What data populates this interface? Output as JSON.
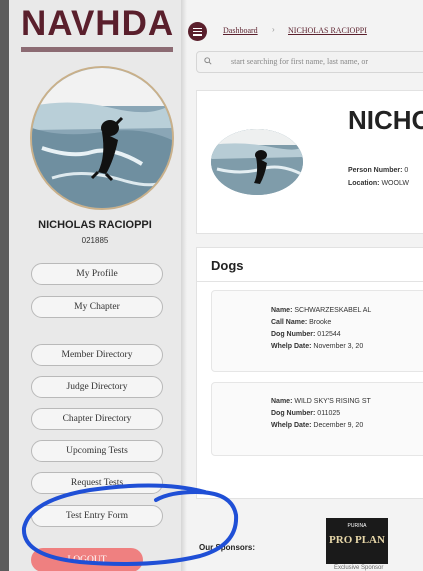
{
  "app": {
    "logo_text": "NAVHDA"
  },
  "breadcrumb": {
    "dashboard": "Dashboard",
    "current": "NICHOLAS RACIOPPI"
  },
  "search": {
    "placeholder": "start searching for first name, last name, or"
  },
  "profile": {
    "name": "NICHOLAS RACIOPPI",
    "number": "021885"
  },
  "sidebar": {
    "buttons": [
      {
        "label": "My Profile"
      },
      {
        "label": "My Chapter"
      },
      {
        "label": "Member Directory"
      },
      {
        "label": "Judge Directory"
      },
      {
        "label": "Chapter Directory"
      },
      {
        "label": "Upcoming Tests"
      },
      {
        "label": "Request Tests"
      },
      {
        "label": "Test Entry Form"
      }
    ],
    "logout": "LOGOUT"
  },
  "header_card": {
    "name": "NICHO",
    "person_number_label": "Person Number:",
    "person_number_value": "0",
    "location_label": "Location:",
    "location_value": "WOOLW"
  },
  "dogs": {
    "title": "Dogs",
    "items": [
      {
        "name_label": "Name:",
        "name": "SCHWARZESKABEL AL",
        "call_label": "Call Name:",
        "call": "Brooke",
        "number_label": "Dog Number:",
        "number": "012544",
        "whelp_label": "Whelp Date:",
        "whelp": "November 3, 20"
      },
      {
        "name_label": "Name:",
        "name": "WILD SKY'S RISING ST",
        "number_label": "Dog Number:",
        "number": "011025",
        "whelp_label": "Whelp Date:",
        "whelp": "December 9, 20"
      }
    ]
  },
  "sponsors": {
    "label": "Our Sponsors:",
    "logo_top": "PURINA",
    "logo_main": "PRO PLAN",
    "caption": "Exclusive Sponsor"
  },
  "colors": {
    "brand": "#5a1f2c",
    "logout": "#ef8080",
    "annotation": "#1f4fd6"
  }
}
